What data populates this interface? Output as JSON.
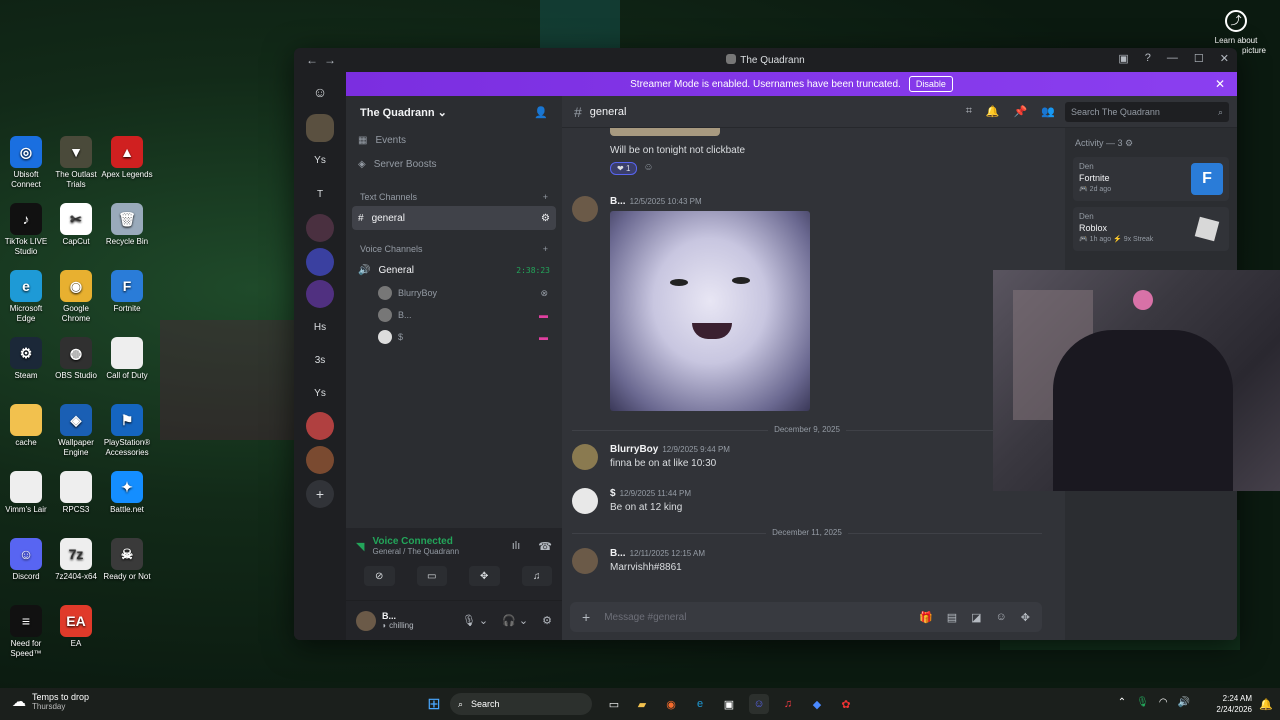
{
  "desktop": {
    "icons": [
      {
        "label": "Ubisoft Connect",
        "icon": "ubisoft-icon",
        "color": "#1a6fe0",
        "glyph": "◎"
      },
      {
        "label": "The Outlast Trials",
        "icon": "outlast-icon",
        "color": "#4a4a3a",
        "glyph": "▼"
      },
      {
        "label": "Apex Legends",
        "icon": "apex-icon",
        "color": "#d02020",
        "glyph": "▲"
      },
      {
        "label": "TikTok LIVE Studio",
        "icon": "tiktok-icon",
        "color": "#111",
        "glyph": "♪"
      },
      {
        "label": "CapCut",
        "icon": "capcut-icon",
        "color": "#fff",
        "glyph": "✂"
      },
      {
        "label": "Recycle Bin",
        "icon": "recycle-bin-icon",
        "color": "#9ab",
        "glyph": "🗑"
      },
      {
        "label": "Microsoft Edge",
        "icon": "edge-icon",
        "color": "#1e9ad6",
        "glyph": "e"
      },
      {
        "label": "Google Chrome",
        "icon": "chrome-icon",
        "color": "#e8b030",
        "glyph": "◉"
      },
      {
        "label": "Fortnite",
        "icon": "fortnite-icon",
        "color": "#2a7cd8",
        "glyph": "F"
      },
      {
        "label": "Steam",
        "icon": "steam-icon",
        "color": "#1b2838",
        "glyph": "⚙"
      },
      {
        "label": "OBS Studio",
        "icon": "obs-icon",
        "color": "#303030",
        "glyph": "◍"
      },
      {
        "label": "Call of Duty",
        "icon": "file-icon",
        "color": "#eee",
        "glyph": ""
      },
      {
        "label": "cache",
        "icon": "folder-icon",
        "color": "#f2c14e",
        "glyph": ""
      },
      {
        "label": "Wallpaper Engine",
        "icon": "wallpaper-engine-icon",
        "color": "#1a5fb4",
        "glyph": "◈"
      },
      {
        "label": "PlayStation® Accessories",
        "icon": "playstation-icon",
        "color": "#1565c0",
        "glyph": "⚑"
      },
      {
        "label": "Vimm's Lair",
        "icon": "file-icon",
        "color": "#eee",
        "glyph": ""
      },
      {
        "label": "RPCS3",
        "icon": "file-icon",
        "color": "#eee",
        "glyph": ""
      },
      {
        "label": "Battle.net",
        "icon": "battlenet-icon",
        "color": "#148eff",
        "glyph": "✦"
      },
      {
        "label": "Discord",
        "icon": "discord-icon",
        "color": "#5865f2",
        "glyph": "☺"
      },
      {
        "label": "7z2404-x64",
        "icon": "7zip-icon",
        "color": "#eee",
        "glyph": "7z"
      },
      {
        "label": "Ready or Not",
        "icon": "ready-or-not-icon",
        "color": "#3a3a3a",
        "glyph": "☠"
      },
      {
        "label": "Need for Speed™",
        "icon": "nfs-icon",
        "color": "#111",
        "glyph": "≡"
      },
      {
        "label": "EA",
        "icon": "ea-icon",
        "color": "#e03a2a",
        "glyph": "EA"
      }
    ],
    "pip": {
      "label": "Learn about",
      "label2": "picture"
    }
  },
  "window": {
    "title": "The Quadrann",
    "banner": {
      "text": "Streamer Mode is enabled. Usernames have been truncated.",
      "button": "Disable"
    }
  },
  "guilds": [
    "Ys",
    "T",
    "Hs",
    "3s",
    "Ys"
  ],
  "sidebar": {
    "server_name": "The Quadrann",
    "events": "Events",
    "boosts": "Server Boosts",
    "text_cat": "Text Channels",
    "text_channel": "general",
    "voice_cat": "Voice Channels",
    "voice_channel": "General",
    "voice_time": "2:38:23",
    "voice_users": [
      "BlurryBoy",
      "B...",
      "$"
    ]
  },
  "voice": {
    "status": "Voice Connected",
    "location": "General / The Quadrann"
  },
  "user": {
    "name": "B...",
    "status": "chilling"
  },
  "channel": {
    "name": "general",
    "search_placeholder": "Search The Quadrann",
    "composer_placeholder": "Message #general"
  },
  "messages": {
    "m0": {
      "text": "Will be on tonight not clickbate",
      "reaction": "1"
    },
    "m1": {
      "name": "B...",
      "time": "12/5/2025 10:43 PM"
    },
    "d1": "December 9, 2025",
    "m2": {
      "name": "BlurryBoy",
      "time": "12/9/2025 9:44 PM",
      "text": "finna be on at like 10:30"
    },
    "m3": {
      "name": "$",
      "time": "12/9/2025 11:44 PM",
      "text": "Be on at 12 king"
    },
    "d2": "December 11, 2025",
    "m4": {
      "name": "B...",
      "time": "12/11/2025 12:15 AM",
      "text": "Marrvishh#8861"
    }
  },
  "activity": {
    "header": "Activity — 3",
    "items": [
      {
        "who": "Den",
        "game": "Fortnite",
        "meta": "2d ago",
        "color": "#2a7cd8"
      },
      {
        "who": "Den",
        "game": "Roblox",
        "meta": "1h ago",
        "streak": "9x Streak",
        "color": "#d8d8d8"
      }
    ]
  },
  "taskbar": {
    "weather": "Temps to drop",
    "weather_sub": "Thursday",
    "search": "Search",
    "time": "2:24 AM",
    "date": "2/24/2026"
  }
}
